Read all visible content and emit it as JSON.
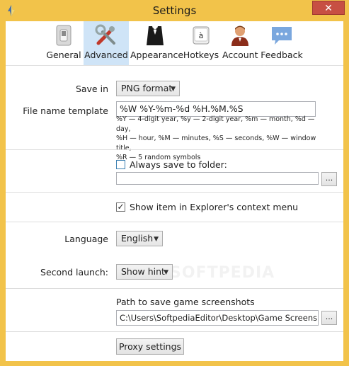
{
  "window": {
    "title": "Settings",
    "close_label": "✕",
    "frame_color": "#f2c34a"
  },
  "toolbar": {
    "items": [
      {
        "label": "General",
        "icon": "switch-icon",
        "active": false
      },
      {
        "label": "Advanced",
        "icon": "tools-icon",
        "active": true
      },
      {
        "label": "Appearance",
        "icon": "tuxedo-icon",
        "active": false
      },
      {
        "label": "Hotkeys",
        "icon": "key-icon",
        "active": false
      },
      {
        "label": "Account",
        "icon": "user-icon",
        "active": false
      },
      {
        "label": "Feedback",
        "icon": "chat-bubble-icon",
        "active": false
      }
    ],
    "active_color": "#cfe4f7"
  },
  "save_in": {
    "label": "Save in",
    "value": "PNG format"
  },
  "file_name_template": {
    "label": "File name template",
    "value": "%W %Y-%m-%d %H.%M.%S",
    "hint_lines": [
      "%Y — 4-digit year, %y — 2-digit year, %m — month, %d — day,",
      "%H — hour, %M — minutes, %S — seconds, %W — window title,",
      "%R — 5 random symbols"
    ]
  },
  "always_save": {
    "label": "Always save to folder:",
    "checked": false,
    "path": "",
    "browse_label": "..."
  },
  "explorer_menu": {
    "label": "Show item in Explorer's context menu",
    "checked": true
  },
  "language": {
    "label": "Language",
    "value": "English"
  },
  "second_launch": {
    "label": "Second launch:",
    "value": "Show hint"
  },
  "game_path": {
    "label": "Path to save game screenshots",
    "value": "C:\\Users\\SoftpediaEditor\\Desktop\\Game Screenshots",
    "browse_label": "..."
  },
  "proxy": {
    "button_label": "Proxy settings"
  },
  "watermark": "SOFTPEDIA"
}
